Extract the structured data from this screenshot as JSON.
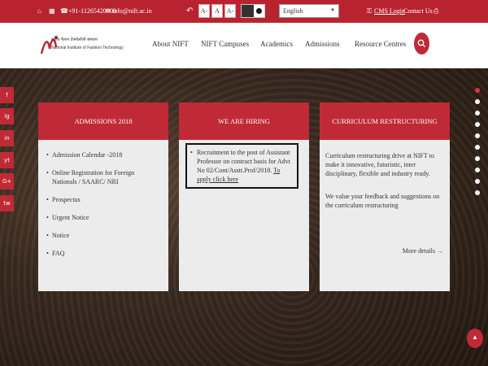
{
  "topbar": {
    "phone": "+91-11265420000",
    "email": "info@nift.ac.in",
    "font_decrease": "A-",
    "font_normal": "A",
    "font_increase": "A-",
    "language": "English",
    "cms_login": "CMS Login",
    "contact_us": "Contact Us"
  },
  "logo": {
    "hindi": "राष्ट्रीय फैशन टेक्नोलॉजी संस्थान",
    "english": "National Institute of Fashion Technology"
  },
  "nav": {
    "items": [
      "About NIFT",
      "NIFT Campuses",
      "Academics",
      "Admissions",
      "Resource Centres"
    ]
  },
  "social": [
    "f",
    "ig",
    "in",
    "yt",
    "G+",
    "tw"
  ],
  "cards": {
    "admissions": {
      "title": "ADMISSIONS 2018",
      "items": [
        "Admission Calendar -2018",
        "Online Registration for Foreign Nationals / SAARC/ NRI",
        "Prospectus",
        "Urgent Notice",
        "Notice",
        "FAQ"
      ]
    },
    "hiring": {
      "title": "WE ARE HIRING",
      "text": "Recruitment to the post of Assistant Professor on contract basis for Advt No 02/Cont/Asstt.Prof/2018.",
      "link": "To apply click here"
    },
    "curriculum": {
      "title": "CURRICULUM RESTRUCTURING",
      "para1": "Curriculum restructuring drive at NIFT to make it innovative, futuristic, inter disciplinary, flexible and industry ready.",
      "para2": "We value your feedback and suggestions on the curriculum restructuring",
      "more": "More details"
    }
  },
  "colors": {
    "brand_red": "#b8232f",
    "card_bg": "#ececec"
  }
}
